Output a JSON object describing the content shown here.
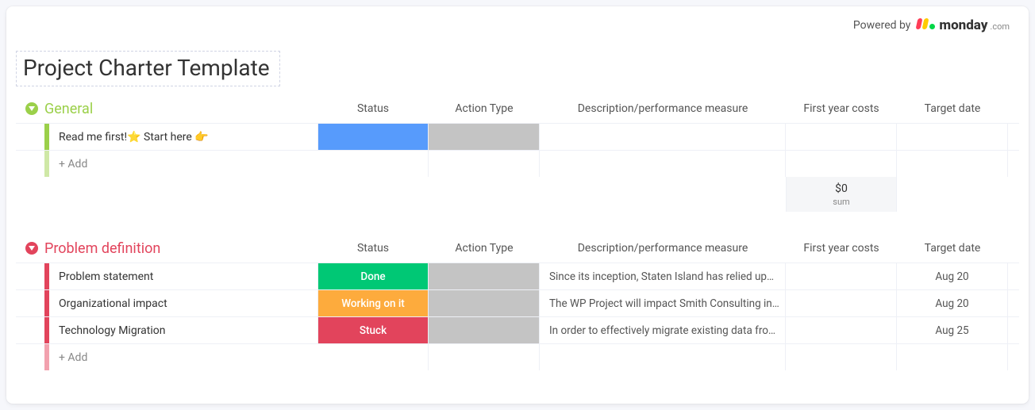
{
  "powered_by_label": "Powered by",
  "brand_name": "monday",
  "brand_suffix": ".com",
  "page_title": "Project Charter Template",
  "columns": {
    "status": "Status",
    "action_type": "Action Type",
    "description": "Description/performance measure",
    "first_year_costs": "First year costs",
    "target_date": "Target date"
  },
  "add_label": "+ Add",
  "groups": [
    {
      "name": "General",
      "color": "#9bd04a",
      "accent": "#9bd04a",
      "accent_light": "#cfe8a6",
      "rows": [
        {
          "name": "Read me first!⭐ Start here 👉",
          "status_label": "",
          "status_color": "#579bfc",
          "action_filled": true,
          "description": "",
          "cost": "",
          "date": ""
        }
      ],
      "footer": {
        "cost_value": "$0",
        "cost_sub": "sum"
      }
    },
    {
      "name": "Problem definition",
      "color": "#e2445c",
      "accent": "#e2445c",
      "accent_light": "#f2a1ae",
      "rows": [
        {
          "name": "Problem statement",
          "status_label": "Done",
          "status_color": "#00c875",
          "action_filled": true,
          "description": "Since its inception, Staten Island has relied up…",
          "cost": "",
          "date": "Aug 20"
        },
        {
          "name": "Organizational impact",
          "status_label": "Working on it",
          "status_color": "#fdab3d",
          "action_filled": true,
          "description": "The WP Project will impact Smith Consulting in…",
          "cost": "",
          "date": "Aug 20"
        },
        {
          "name": "Technology Migration",
          "status_label": "Stuck",
          "status_color": "#e2445c",
          "action_filled": true,
          "description": "In order to effectively migrate existing data fro…",
          "cost": "",
          "date": "Aug 25"
        }
      ],
      "footer": null
    }
  ]
}
